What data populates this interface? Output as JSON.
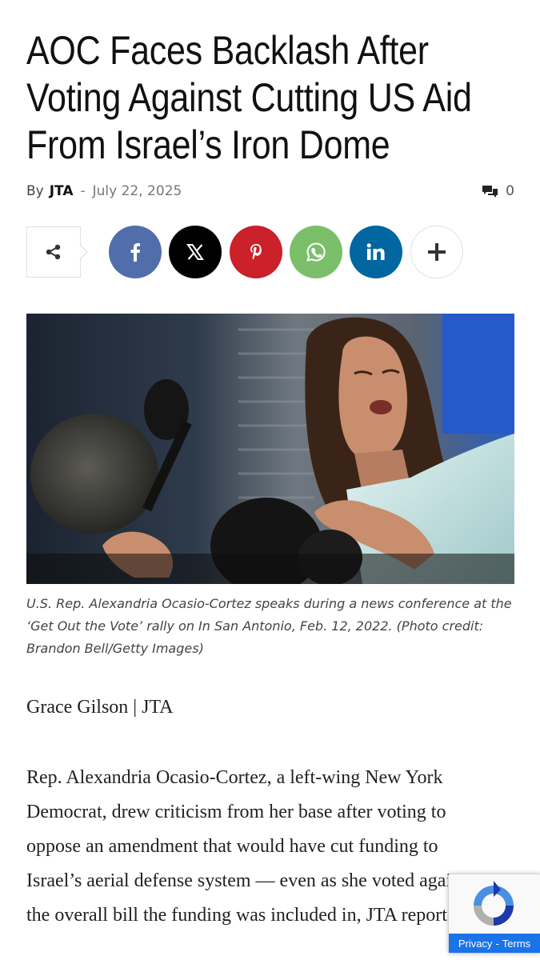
{
  "article": {
    "headline": "AOC Faces Backlash After Voting Against Cutting US Aid From Israel’s Iron Dome",
    "by_label": "By",
    "author": "JTA",
    "separator": "-",
    "date": "July 22, 2025",
    "comment_count": "0",
    "photo_caption": "U.S. Rep. Alexandria Ocasio-Cortez speaks during a news conference at the ‘Get Out the Vote’ rally on In San Antonio, Feb. 12, 2022. (Photo credit: Brandon Bell/Getty Images)",
    "byline": "Grace Gilson | JTA",
    "body": "Rep. Alexandria Ocasio-Cortez, a left-wing New York\nDemocrat, drew criticism from her base after voting to\noppose an amendment that would have cut funding to\nIsrael’s aerial defense system — even as she voted against\nthe overall bill the funding was included in, JTA reported."
  },
  "share": {
    "share_icon": "share-icon",
    "buttons": [
      {
        "name": "facebook",
        "icon": "facebook-icon",
        "color": "#516eab"
      },
      {
        "name": "x",
        "icon": "x-icon",
        "color": "#000000"
      },
      {
        "name": "pinterest",
        "icon": "pinterest-icon",
        "color": "#ca212a"
      },
      {
        "name": "whatsapp",
        "icon": "whatsapp-icon",
        "color": "#7bbf6a"
      },
      {
        "name": "linkedin",
        "icon": "linkedin-icon",
        "color": "#0266a0"
      },
      {
        "name": "more",
        "icon": "plus-icon",
        "color": "#ffffff"
      }
    ]
  },
  "recaptcha": {
    "privacy": "Privacy",
    "dash": "-",
    "terms": "Terms"
  }
}
